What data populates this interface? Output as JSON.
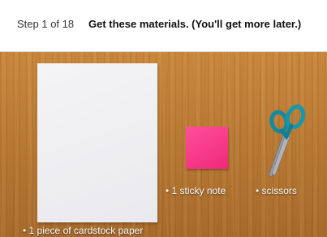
{
  "header": {
    "step_count": "Step 1 of 18",
    "title": "Get these materials. (You'll get more later.)"
  },
  "materials": [
    {
      "name": "1 piece of cardstock paper",
      "label": "• 1 piece of cardstock paper",
      "color": "#eeeef1"
    },
    {
      "name": "1 sticky note",
      "label": "• 1 sticky note",
      "color": "#f5318a"
    },
    {
      "name": "scissors",
      "label": "• scissors",
      "color": "#1a8aa0",
      "icon": "scissors-icon"
    }
  ],
  "colors": {
    "wood": "#b97a34",
    "header_bg": "#ffffff",
    "label_text": "#ffffff"
  }
}
